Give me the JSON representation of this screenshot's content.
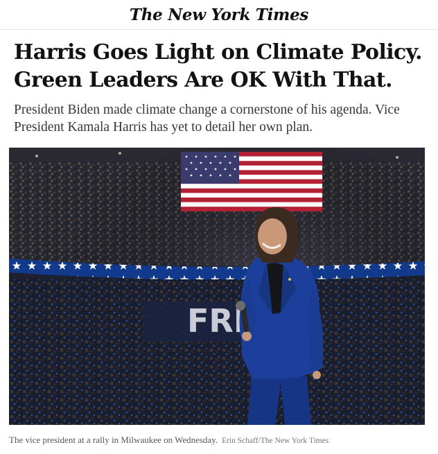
{
  "masthead": {
    "logo_text": "The New York Times"
  },
  "article": {
    "headline_line1": "Harris Goes Light on Climate Policy.",
    "headline_line2": "Green Leaders Are OK With That.",
    "dek": "President Biden made climate change a cornerstone of his agenda. Vice President Kamala Harris has yet to detail her own plan.",
    "photo": {
      "sign_text": "FRE",
      "caption": "The vice president at a rally in Milwaukee on Wednesday.",
      "credit": "Erin Schaff/The New York Times"
    }
  },
  "colors": {
    "headline": "#121212",
    "dek": "#363636",
    "arena_dark": "#1a1d2a",
    "banner_blue": "#123a8c",
    "suit_blue": "#1b3f9a",
    "flag_red": "#b22234"
  }
}
